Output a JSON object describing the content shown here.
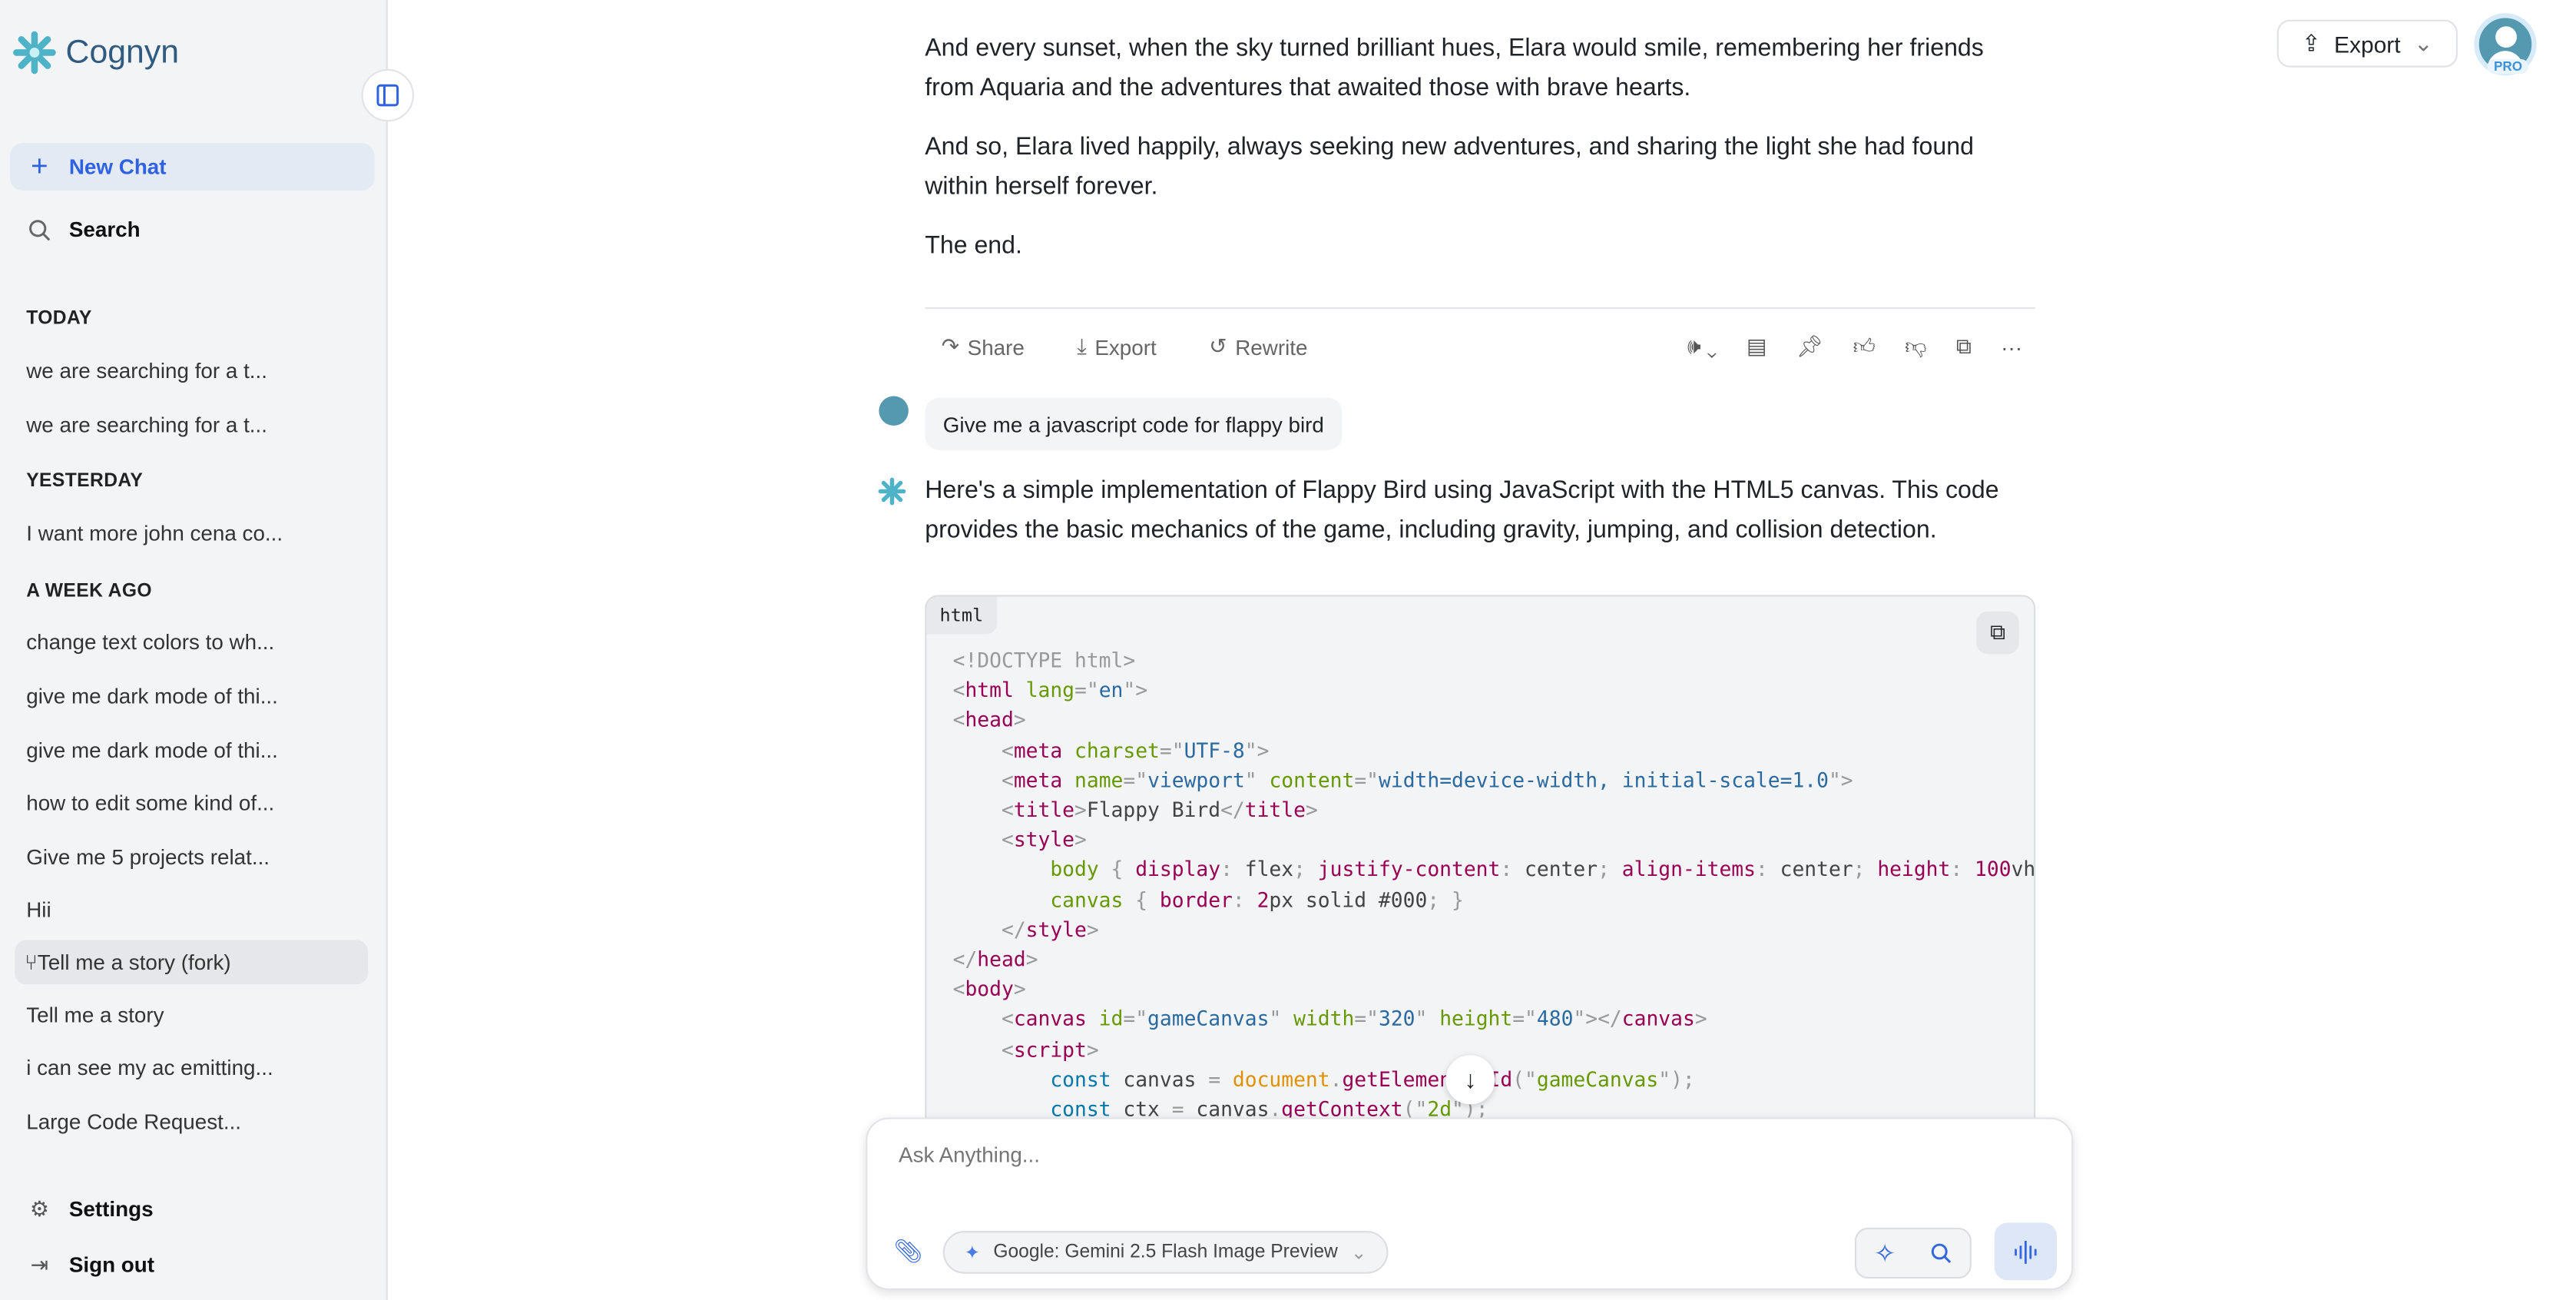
{
  "app": {
    "name": "Cognyn"
  },
  "sidebar": {
    "new_chat": "New Chat",
    "search": "Search",
    "sections": [
      {
        "title": "TODAY",
        "items": [
          "we are searching for a t...",
          "we are searching for a t..."
        ]
      },
      {
        "title": "YESTERDAY",
        "items": [
          "I want more john cena co..."
        ]
      },
      {
        "title": "A WEEK AGO",
        "items": [
          "change text colors to wh...",
          "give me dark mode of thi...",
          "give me dark mode of thi...",
          "how to edit some kind of...",
          "Give me 5 projects relat...",
          "Hii",
          "Tell me a story (fork)",
          "Tell me a story",
          "i can see my ac emitting...",
          "Large Code Request..."
        ]
      }
    ],
    "active_item": "Tell me a story (fork)",
    "settings": "Settings",
    "sign_out": "Sign out"
  },
  "header": {
    "export": "Export",
    "badge": "PRO"
  },
  "messages": {
    "story": [
      "And every sunset, when the sky turned brilliant hues, Elara would smile, remembering her friends from Aquaria and the adventures that awaited those with brave hearts.",
      "And so, Elara lived happily, always seeking new adventures, and sharing the light she had found within herself forever.",
      "The end."
    ],
    "actions": {
      "share": "Share",
      "export": "Export",
      "rewrite": "Rewrite"
    },
    "user": "Give me a javascript code for flappy bird",
    "assistant": "Here's a simple implementation of Flappy Bird using JavaScript with the HTML5 canvas. This code provides the basic mechanics of the game, including gravity, jumping, and collision detection.",
    "code_lang": "html",
    "code": [
      [
        [
          "p",
          "<!DOCTYPE html>"
        ]
      ],
      [
        [
          "p",
          "<"
        ],
        [
          "t",
          "html"
        ],
        [
          "a",
          " lang"
        ],
        [
          "p",
          "=\""
        ],
        [
          "s",
          "en"
        ],
        [
          "p",
          "\">"
        ]
      ],
      [
        [
          "p",
          "<"
        ],
        [
          "t",
          "head"
        ],
        [
          "p",
          ">"
        ]
      ],
      [
        [
          "d",
          "    "
        ],
        [
          "p",
          "<"
        ],
        [
          "t",
          "meta"
        ],
        [
          "a",
          " charset"
        ],
        [
          "p",
          "=\""
        ],
        [
          "s",
          "UTF-8"
        ],
        [
          "p",
          "\">"
        ]
      ],
      [
        [
          "d",
          "    "
        ],
        [
          "p",
          "<"
        ],
        [
          "t",
          "meta"
        ],
        [
          "a",
          " name"
        ],
        [
          "p",
          "=\""
        ],
        [
          "s",
          "viewport"
        ],
        [
          "p",
          "\""
        ],
        [
          "a",
          " content"
        ],
        [
          "p",
          "=\""
        ],
        [
          "s",
          "width=device-width, initial-scale=1.0"
        ],
        [
          "p",
          "\">"
        ]
      ],
      [
        [
          "d",
          "    "
        ],
        [
          "p",
          "<"
        ],
        [
          "t",
          "title"
        ],
        [
          "p",
          ">"
        ],
        [
          "d",
          "Flappy Bird"
        ],
        [
          "p",
          "</"
        ],
        [
          "t",
          "title"
        ],
        [
          "p",
          ">"
        ]
      ],
      [
        [
          "d",
          "    "
        ],
        [
          "p",
          "<"
        ],
        [
          "t",
          "style"
        ],
        [
          "p",
          ">"
        ]
      ],
      [
        [
          "d",
          "        "
        ],
        [
          "a",
          "body"
        ],
        [
          "p",
          " { "
        ],
        [
          "t",
          "display"
        ],
        [
          "p",
          ": "
        ],
        [
          "d",
          "flex"
        ],
        [
          "p",
          "; "
        ],
        [
          "t",
          "justify-content"
        ],
        [
          "p",
          ": "
        ],
        [
          "d",
          "center"
        ],
        [
          "p",
          "; "
        ],
        [
          "t",
          "align-items"
        ],
        [
          "p",
          ": "
        ],
        [
          "d",
          "center"
        ],
        [
          "p",
          "; "
        ],
        [
          "t",
          "height"
        ],
        [
          "p",
          ": "
        ],
        [
          "t",
          "100"
        ],
        [
          "d",
          "vh"
        ],
        [
          "p",
          ";"
        ]
      ],
      [
        [
          "d",
          "        "
        ],
        [
          "a",
          "canvas"
        ],
        [
          "p",
          " { "
        ],
        [
          "t",
          "border"
        ],
        [
          "p",
          ": "
        ],
        [
          "t",
          "2"
        ],
        [
          "d",
          "px solid #000"
        ],
        [
          "p",
          "; }"
        ]
      ],
      [
        [
          "d",
          "    "
        ],
        [
          "p",
          "</"
        ],
        [
          "t",
          "style"
        ],
        [
          "p",
          ">"
        ]
      ],
      [
        [
          "p",
          "</"
        ],
        [
          "t",
          "head"
        ],
        [
          "p",
          ">"
        ]
      ],
      [
        [
          "p",
          "<"
        ],
        [
          "t",
          "body"
        ],
        [
          "p",
          ">"
        ]
      ],
      [
        [
          "d",
          "    "
        ],
        [
          "p",
          "<"
        ],
        [
          "t",
          "canvas"
        ],
        [
          "a",
          " id"
        ],
        [
          "p",
          "=\""
        ],
        [
          "s",
          "gameCanvas"
        ],
        [
          "p",
          "\""
        ],
        [
          "a",
          " width"
        ],
        [
          "p",
          "=\""
        ],
        [
          "s",
          "320"
        ],
        [
          "p",
          "\""
        ],
        [
          "a",
          " height"
        ],
        [
          "p",
          "=\""
        ],
        [
          "s",
          "480"
        ],
        [
          "p",
          "\"></"
        ],
        [
          "t",
          "canvas"
        ],
        [
          "p",
          ">"
        ]
      ],
      [
        [
          "d",
          "    "
        ],
        [
          "p",
          "<"
        ],
        [
          "t",
          "script"
        ],
        [
          "p",
          ">"
        ]
      ],
      [
        [
          "d",
          "        "
        ],
        [
          "k",
          "const"
        ],
        [
          "d",
          " canvas "
        ],
        [
          "p",
          "= "
        ],
        [
          "o",
          "document"
        ],
        [
          "p",
          "."
        ],
        [
          "t",
          "getElementById"
        ],
        [
          "p",
          "(\""
        ],
        [
          "a",
          "gameCanvas"
        ],
        [
          "p",
          "\");"
        ]
      ],
      [
        [
          "d",
          "        "
        ],
        [
          "k",
          "const"
        ],
        [
          "d",
          " ctx "
        ],
        [
          "p",
          "= "
        ],
        [
          "d",
          "canvas"
        ],
        [
          "p",
          "."
        ],
        [
          "t",
          "getContext"
        ],
        [
          "p",
          "(\""
        ],
        [
          "a",
          "2d"
        ],
        [
          "p",
          "\");"
        ]
      ]
    ]
  },
  "composer": {
    "placeholder": "Ask Anything...",
    "model": "Google: Gemini 2.5 Flash Image Preview"
  }
}
